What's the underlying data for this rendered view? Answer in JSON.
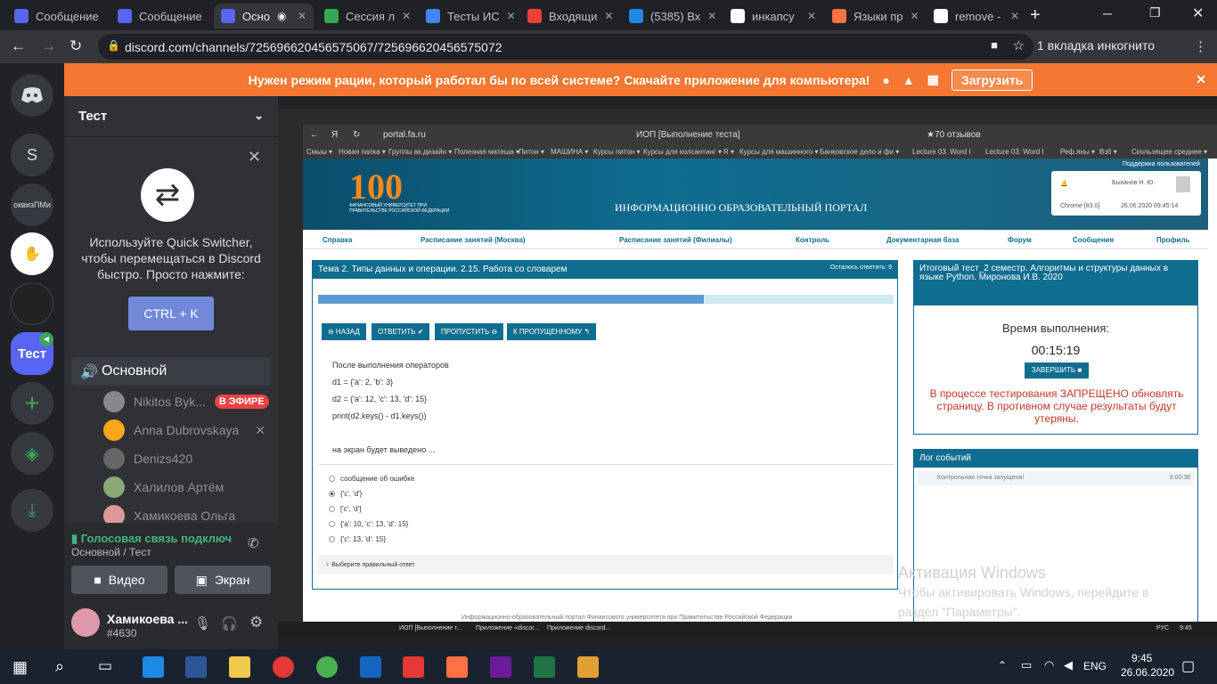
{
  "chrome": {
    "tabs": [
      {
        "label": "Сообщение",
        "color": "#5865f2"
      },
      {
        "label": "Сообщение",
        "color": "#5865f2"
      },
      {
        "label": "Осно",
        "color": "#5865f2"
      },
      {
        "label": "Сессия л",
        "color": "#34a853"
      },
      {
        "label": "Тесты ИС",
        "color": "#4285f4"
      },
      {
        "label": "Входящи",
        "color": "#ea4335"
      },
      {
        "label": "(5385) Вх",
        "color": "#1e88e5"
      },
      {
        "label": "инкапсу",
        "color": "#ffffff"
      },
      {
        "label": "Языки пр",
        "color": "#ff7043"
      },
      {
        "label": "remove -",
        "color": "#ffffff"
      }
    ],
    "url": "discord.com/channels/725696620456575067/725696620456575072",
    "incognito_label": "1 вкладка инкогнито"
  },
  "banner": {
    "text": "Нужен режим рации, который работал бы по всей системе? Скачайте приложение для компьютера!",
    "download": "Загрузить"
  },
  "guilds": {
    "s": "S",
    "kviz": "оквизПМи",
    "test": "Тест"
  },
  "sidebar": {
    "server_name": "Тест",
    "qs_text": "Используйте Quick Switcher, чтобы перемещаться в Discord быстро. Просто нажмите:",
    "qs_key": "CTRL + K",
    "channel_name": "Основной",
    "users": [
      {
        "name": "Nikitos Byk...",
        "badge": "В ЭФИРЕ"
      },
      {
        "name": "Anna Dubrovskaya",
        "badge": ""
      },
      {
        "name": "Denizs420",
        "badge": ""
      },
      {
        "name": "Халилов Артём",
        "badge": ""
      },
      {
        "name": "Хамикоева Ольга",
        "badge": ""
      }
    ],
    "voice_status": "Голосовая связь подключ",
    "voice_channel": "Основной / Тест",
    "video": "Видео",
    "screen": "Экран",
    "me_name": "Хамикоева ...",
    "me_tag": "#4630"
  },
  "portal": {
    "inner_url": "portal.fa.ru",
    "inner_title": "ИОП [Выполнение теста]",
    "reviews": "★70 отзывов",
    "bookmarks": [
      "Смыы ▾",
      "Новая папка ▾",
      "Группы вк.дизайн ▾",
      "Полезная матеша ▾",
      "Питон ▾",
      "МАШИНА ▾",
      "Курсы питон ▾",
      "Курсы для колсантинг ▾",
      "R ▾",
      "Курсы для машинного ▾",
      "Банковское дело и фи ▾",
      "Lecture 03. Word I",
      "Lecture 03. Word I",
      "Реф.яны ▾",
      "Взб ▾",
      "Скользящее среднее ▾"
    ],
    "logo": "100",
    "logo_sub": "ФИНАНСОВЫЙ УНИВЕРСИТЕТ ПРИ ПРАВИТЕЛЬСТВЕ РОССИЙСКОЙ ФЕДЕРАЦИИ",
    "title": "ИНФОРМАЦИОННО ОБРАЗОВАТЕЛЬНЫЙ ПОРТАЛ",
    "support": "Поддержка пользователей",
    "user": "Быханов Н. Ю.",
    "browser": "Chrome [83.0]",
    "datetime": "26.06.2020 09:45:14",
    "nav": [
      "Справка",
      "Расписание занятий (Москва)",
      "Расписание занятий (Филиалы)",
      "Контроль",
      "Документарная база",
      "Форум",
      "Сообщения",
      "Профиль"
    ],
    "topic": "Тема 2. Типы данных и операции. 2.15. Работа со словарем",
    "remaining": "Осталось ответить: 9",
    "progress": 0.67,
    "buttons": [
      "⊖ НАЗАД",
      "ОТВЕТИТЬ ✔",
      "ПРОПУСТИТЬ ⊖",
      "К ПРОПУЩЕННОМУ ↰"
    ],
    "question": [
      "После выполнения операторов",
      "d1 = {'a': 2, 'b': 3}",
      "d2 = {'a': 12, 'c': 13, 'd': 15}",
      "print(d2.keys() - d1.keys())",
      "",
      "на экран будет выведено ..."
    ],
    "options": [
      "сообщение об ошибке",
      "{'c', 'd'}",
      "['c', 'd']",
      "{'a': 10, 'c': 13, 'd': 15}",
      "{'c': 13, 'd': 15}"
    ],
    "hint": "♀ Выберите правильный ответ",
    "test_title": "Итоговый тест_2 семестр. Алгоритмы и структуры данных в языке Python. Миронова И.В. 2020",
    "time_label": "Время выполнения:",
    "time_value": "00:15:19",
    "finish": "ЗАВЕРШИТЬ ■",
    "warning": "В процессе тестирования ЗАПРЕЩЕНО обновлять страницу. В противном случае результаты будут утеряны.",
    "log_title": "Лог событий",
    "log_entry": "Контрольная точка запущена!",
    "log_time": "9:00:38",
    "footer": "Информационно-образовательный портал Финансового университета при Правительстве Российской Федерации",
    "taskbar_items": [
      "ИОП [Выполнение т...",
      "Приложение «discor...",
      "Приложение discord..."
    ],
    "taskbar_lang": "РУС",
    "taskbar_time": "9:45"
  },
  "watermark": {
    "title": "Активация Windows",
    "line": "Чтобы активировать Windows, перейдите в раздел \"Параметры\"."
  },
  "wtaskbar": {
    "lang": "ENG",
    "time": "9:45",
    "date": "26.06.2020"
  }
}
